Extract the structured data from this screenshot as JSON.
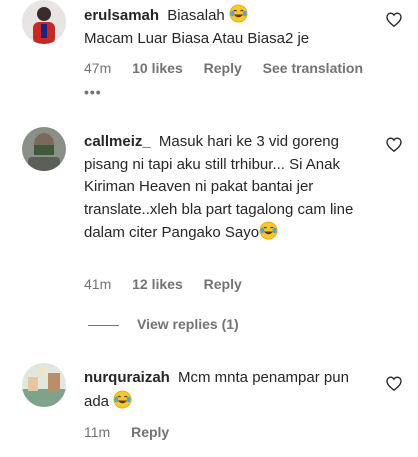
{
  "comments": [
    {
      "username": "erulsamah",
      "text_lines": [
        "Biasalah",
        "Macam Luar Biasa Atau Biasa2 je"
      ],
      "time": "47m",
      "likes": "10 likes",
      "reply": "Reply",
      "see_translation": "See translation",
      "more": "•••"
    },
    {
      "username": "callmeiz_",
      "text": "Masuk hari ke 3 vid goreng pisang ni tapi aku still trhibur... Si Anak Kiriman Heaven ni pakat bantai jer translate..xleh bla part tagalong cam line dalam citer Pangako Sayo",
      "time": "41m",
      "likes": "12 likes",
      "reply": "Reply",
      "view_replies": "View replies (1)"
    },
    {
      "username": "nurquraizah",
      "text": "Mcm mnta penampar pun ada",
      "time": "11m",
      "reply": "Reply"
    }
  ],
  "colors": {
    "text": "#262626",
    "secondary": "#737373",
    "background": "#ffffff"
  },
  "icons": {
    "like": "heart-outline-icon",
    "emoji": "tears-of-joy-emoji"
  }
}
